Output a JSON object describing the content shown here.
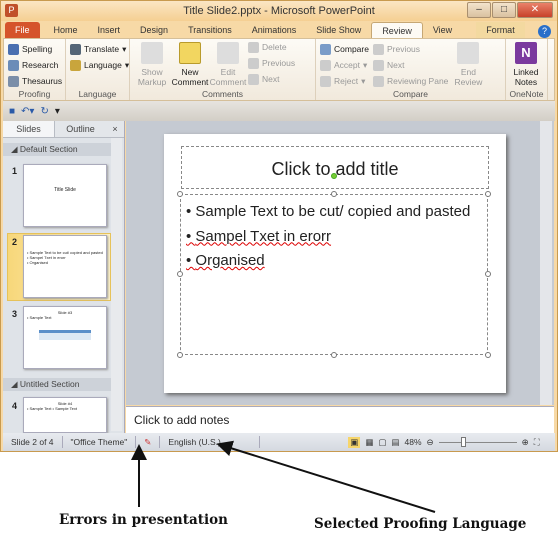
{
  "window": {
    "title": "Title Slide2.pptx - Microsoft PowerPoint",
    "app_icon": "P"
  },
  "tabs": [
    "File",
    "Home",
    "Insert",
    "Design",
    "Transitions",
    "Animations",
    "Slide Show",
    "Review",
    "View",
    "Format"
  ],
  "ribbon": {
    "proofing": {
      "label": "Proofing",
      "items": [
        "Spelling",
        "Research",
        "Thesaurus"
      ]
    },
    "language": {
      "label": "Language",
      "items": [
        "Translate",
        "Language"
      ]
    },
    "show_markup": "Show Markup",
    "comments": {
      "label": "Comments",
      "new": "New Comment",
      "edit": "Edit Comment",
      "items": [
        "Delete",
        "Previous",
        "Next"
      ]
    },
    "compare": {
      "label": "Compare",
      "items": [
        "Compare",
        "Accept",
        "Reject"
      ],
      "items2": [
        "Previous",
        "Next",
        "Reviewing Pane"
      ],
      "end": "End Review"
    },
    "onenote": {
      "label": "OneNote",
      "linked": "Linked Notes"
    }
  },
  "left_panel": {
    "tabs": [
      "Slides",
      "Outline"
    ],
    "close": "×",
    "sections": [
      "Default Section",
      "Untitled Section"
    ],
    "slides": [
      {
        "num": "1",
        "lines": [
          "Title Slide"
        ]
      },
      {
        "num": "2",
        "lines": [
          "• Sample Text to be cut/ copied and pasted",
          "• Sampel Txet in erorr",
          "• Organised"
        ]
      },
      {
        "num": "3",
        "lines": [
          "Slide #3",
          "• Sample Text"
        ]
      },
      {
        "num": "4",
        "lines": [
          "Slide #4",
          "• Sample Text   • Sample Text"
        ]
      }
    ]
  },
  "slide": {
    "title_placeholder": "Click to add title",
    "bullets": [
      {
        "text": "Sample Text to be cut/ copied and pasted"
      },
      {
        "text": "Sampel Txet in erorr"
      },
      {
        "text": "Organised"
      }
    ]
  },
  "notes_placeholder": "Click to add notes",
  "status": {
    "slide": "Slide 2 of 4",
    "theme": "\"Office Theme\"",
    "language": "English (U.S.)",
    "zoom": "48%"
  },
  "annotations": {
    "errors": "Errors in presentation",
    "language": "Selected Proofing Language"
  }
}
